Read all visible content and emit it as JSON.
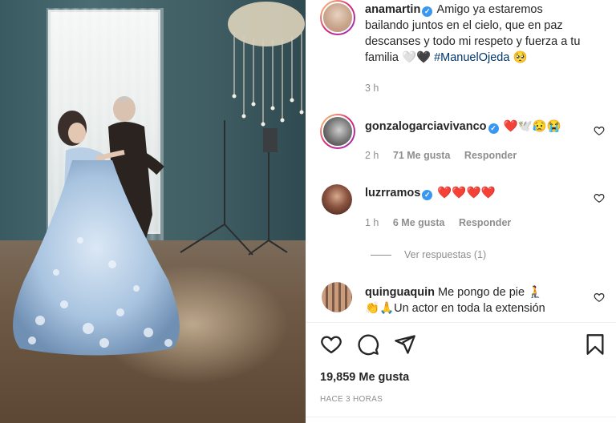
{
  "post": {
    "author": "anamartin",
    "caption": "Amigo ya estaremos bailando juntos en el cielo, que en paz descanses y todo mi respeto y fuerza a tu familia",
    "caption_emoji": "🤍🖤",
    "hashtag": "#ManuelOjeda",
    "hashtag_emoji": "🥺",
    "age": "3 h"
  },
  "comments": [
    {
      "user": "gonzalogarciavivanco",
      "text": "❤️🕊️😥😭",
      "age": "2 h",
      "likes": "71 Me gusta",
      "reply": "Responder"
    },
    {
      "user": "luzrramos",
      "text": "❤️❤️❤️❤️",
      "age": "1 h",
      "likes": "6 Me gusta",
      "reply": "Responder"
    },
    {
      "user": "quinguaquin",
      "text": "Me pongo de pie 🧎",
      "text2": "👏🙏Un actor en toda la extensión"
    }
  ],
  "view_replies": "Ver respuestas (1)",
  "likes_total": "19,859 Me gusta",
  "timestamp": "HACE 3 HORAS",
  "icons": {
    "like": "heart-outline-icon",
    "comment": "comment-bubble-icon",
    "share": "paper-plane-icon",
    "save": "bookmark-icon"
  },
  "colors": {
    "verified": "#3897f0",
    "hashtag": "#00376b",
    "muted": "#8e8e8e",
    "heart": "#ed4956"
  }
}
